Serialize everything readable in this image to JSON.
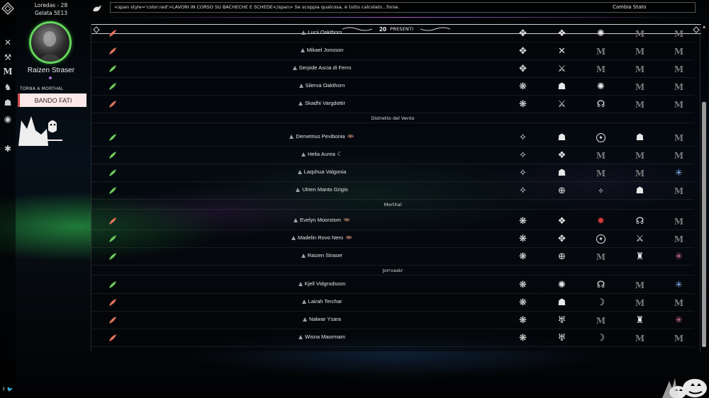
{
  "sidebar": {
    "date": "Loredas - 28",
    "time": "Gelata 5E13",
    "profile_name": "Raizen Straser",
    "back_link": "TORNA A MORTHAL",
    "bando_button": "BANDO FATI",
    "icons": [
      "logo-icon",
      "crossed-swords-icon",
      "hammer-icon",
      "m-emblem-icon",
      "dragon-icon",
      "mask-icon",
      "spider-icon"
    ]
  },
  "social": {
    "facebook": "f",
    "twitter": "🐦"
  },
  "topbar": {
    "news": "<span style='color:red'>LAVORI IN CORSO SU BACHECHE E SCHEDE</span> Se scoppia qualcosa, è tutto calcolato...forse.",
    "change_status": "Cambia Stato"
  },
  "list": {
    "present_count": "20",
    "present_label": "PRESENTI",
    "rows_top": [
      {
        "name": "Lucii Oakthorn",
        "feather": "red"
      },
      {
        "name": "Mikael Jonsson",
        "feather": "red"
      },
      {
        "name": "Serpide Ascia di Ferro",
        "feather": "green"
      },
      {
        "name": "Silerva Oakthorn",
        "feather": "green"
      },
      {
        "name": "Skadhi Vargdottir",
        "feather": "red"
      }
    ],
    "district_vento": "Distretto del Vento",
    "rows_vento": [
      {
        "name": "Demetrius Pevibonia",
        "feather": "green",
        "badge": "bat"
      },
      {
        "name": "Helia Aurea",
        "feather": "green",
        "badge": "moon"
      },
      {
        "name": "Laqshua Valgonia",
        "feather": "green"
      },
      {
        "name": "Ulrien Manto Grigio",
        "feather": "green"
      }
    ],
    "district_morthal": "Morthal",
    "rows_morthal": [
      {
        "name": "Evelyn Moorstom",
        "feather": "red",
        "badge": "bat"
      },
      {
        "name": "Madelin Rovo Nero",
        "feather": "green",
        "badge": "bat"
      },
      {
        "name": "Raizen Straser",
        "feather": "green"
      }
    ],
    "district_jorrvaskr": "Jorrvaskr",
    "rows_jorrvaskr": [
      {
        "name": "Kjell Vidgrodsson",
        "feather": "green"
      },
      {
        "name": "Lairah Terchar",
        "feather": "red"
      },
      {
        "name": "Nalwar Ysara",
        "feather": "red"
      },
      {
        "name": "Wisna Maormam",
        "feather": "red"
      }
    ]
  },
  "colors": {
    "feather_green": "#6ecb5a",
    "feather_red": "#e5745c",
    "avatar_ring": "#63d65a",
    "bando_accent": "#d24a4a"
  }
}
